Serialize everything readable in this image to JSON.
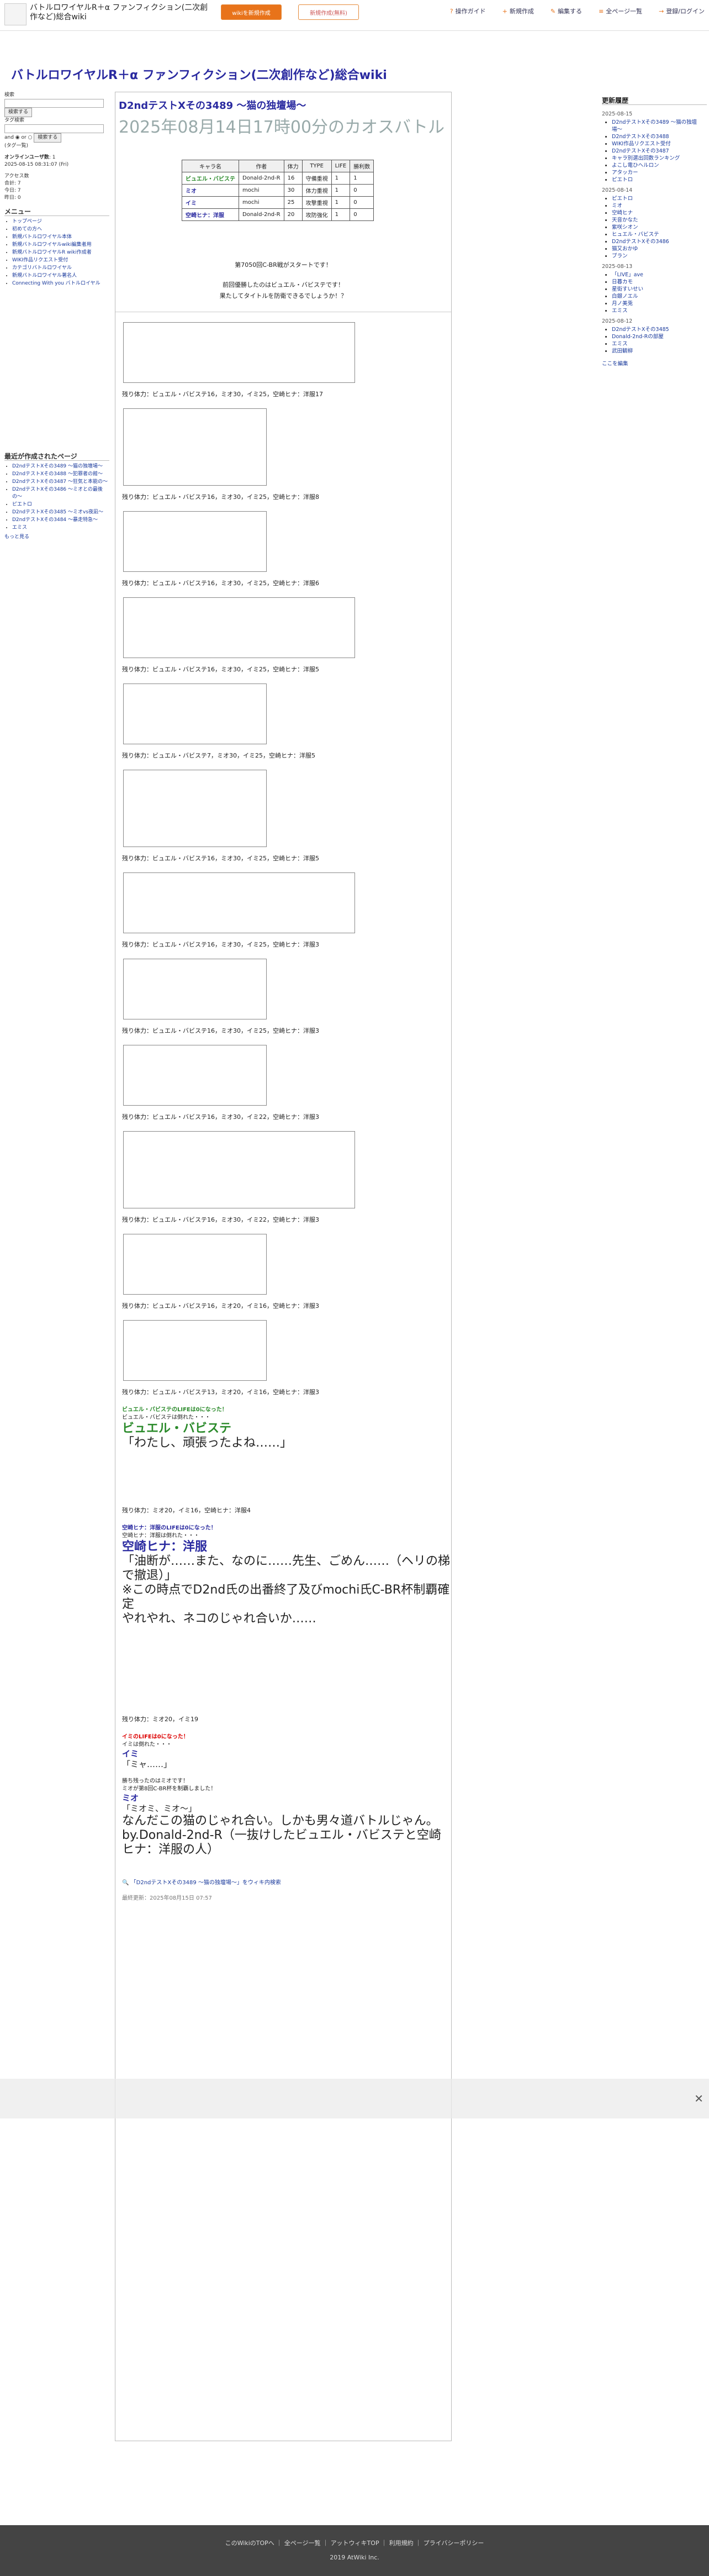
{
  "header": {
    "site_name": "バトルロワイヤルR＋α ファンフィクション(二次創作など)総合wiki",
    "btn1": "wikiを新規作成",
    "btn2": "新規作成(無料)",
    "nav": [
      {
        "icon": "?",
        "label": "操作ガイド"
      },
      {
        "icon": "+",
        "label": "新規作成"
      },
      {
        "icon": "✎",
        "label": "編集する"
      },
      {
        "icon": "≡",
        "label": "全ページ一覧"
      },
      {
        "icon": "→",
        "label": "登録/ログイン"
      }
    ]
  },
  "site_title": "バトルロワイヤルR＋α ファンフィクション(二次創作など)総合wiki",
  "left": {
    "search_label": "検索",
    "search_btn": "検索する",
    "tag_label": "タグ検索",
    "and": "and",
    "or": "or",
    "tag_btn": "検索する",
    "tag_list": "(タグ一覧)",
    "online_label": "オンラインユーザ数",
    "online_value": "1",
    "updated": "2025-08-15 08:31:07 (Fri)",
    "access_label": "アクセス数",
    "access": [
      "合計: 7",
      "今日: 7",
      "昨日: 0"
    ],
    "menu_title": "メニュー",
    "menu_items": [
      "トップページ",
      "初めての方へ",
      "新規バトルロワイヤル本体",
      "新規バトルロワイヤルwiki編集者用",
      "新規バトルロワイヤルR wiki作成者",
      "WIKI作品リクエスト受付",
      "カテゴリバトルロワイヤル",
      "新規バトルロワイヤル著名人",
      "Connecting With you バトルロイヤル"
    ],
    "recent_title": "最近が作成されたページ",
    "recent_items": [
      "D2ndテストXその3489 〜猫の独壇場〜",
      "D2ndテストXその3488 〜犯罪者の館〜",
      "D2ndテストXその3487 〜狂気と本能の〜",
      "D2ndテストXその3486 〜ミオとの最後の〜",
      "ピエトロ",
      "D2ndテストXその3485 〜ミオvs夜凪〜",
      "D2ndテストXその3484 〜暴走特急〜",
      "エミス"
    ],
    "more": "もっと見る"
  },
  "right": {
    "title": "更新履歴",
    "groups": [
      {
        "date": "2025-08-15",
        "items": [
          "D2ndテストXその3489 〜猫の独壇場〜",
          "D2ndテストXその3488",
          "WIKI作品リクエスト受付",
          "D2ndテストXその3487",
          "キャラ別選出回数ランキング",
          "よこし電ひヘルロン",
          "アタッカー",
          "ピエトロ"
        ]
      },
      {
        "date": "2025-08-14",
        "items": [
          "ピエトロ",
          "ミオ",
          "空崎ヒナ",
          "天音かなた",
          "紫咲シオン",
          "ヒュエル・バビステ",
          "D2ndテストXその3486",
          "猫又おかゆ",
          "ブラン"
        ]
      },
      {
        "date": "2025-08-13",
        "items": [
          "「LIVE」ave",
          "日暮カモ",
          "星街すいせい",
          "白銀ノエル",
          "月ノ美兎",
          "エミス"
        ]
      },
      {
        "date": "2025-08-12",
        "items": [
          "D2ndテストXその3485",
          "Donald-2nd-Rの部屋",
          "エミス",
          "武田観柳"
        ]
      }
    ],
    "more": "ここを編集"
  },
  "page": {
    "title": "D2ndテストXその3489 〜猫の独壇場〜",
    "subtitle": "2025年08月14日17時00分のカオスバトル"
  },
  "roster": {
    "headers": [
      "キャラ名",
      "作者",
      "体力",
      "TYPE",
      "LIFE",
      "勝利数"
    ],
    "rows": [
      [
        "ビュエル・バビステ",
        "Donald-2nd-R",
        "16",
        "守備重視",
        "1",
        "1"
      ],
      [
        "ミオ",
        "mochi",
        "30",
        "体力重視",
        "1",
        "0"
      ],
      [
        "イミ",
        "mochi",
        "25",
        "攻撃重視",
        "1",
        "0"
      ],
      [
        "空崎ヒナ：洋服",
        "Donald-2nd-R",
        "20",
        "攻防強化",
        "1",
        "0"
      ]
    ]
  },
  "intro": [
    "第7050回C-BR戦がスタートです！",
    "前回優勝したのはビュエル・バビステです！",
    "果たしてタイトルを防衛できるでしょうか！？"
  ],
  "hp_lines": [
    "残り体力：ビュエル・バビステ16，ミオ30，イミ25，空崎ヒナ：洋服17",
    "残り体力：ビュエル・バビステ16，ミオ30，イミ25，空崎ヒナ：洋服8",
    "残り体力：ビュエル・バビステ16，ミオ30，イミ25，空崎ヒナ：洋服6",
    "残り体力：ビュエル・バビステ16，ミオ30，イミ25，空崎ヒナ：洋服5",
    "残り体力：ビュエル・バビステ7，ミオ30，イミ25，空崎ヒナ：洋服5",
    "残り体力：ビュエル・バビステ16，ミオ30，イミ25，空崎ヒナ：洋服5",
    "残り体力：ビュエル・バビステ16，ミオ30，イミ25，空崎ヒナ：洋服3",
    "残り体力：ビュエル・バビステ16，ミオ30，イミ25，空崎ヒナ：洋服3",
    "残り体力：ビュエル・バビステ16，ミオ30，イミ22，空崎ヒナ：洋服3",
    "残り体力：ビュエル・バビステ16，ミオ30，イミ22，空崎ヒナ：洋服3",
    "残り体力：ビュエル・バビステ16，ミオ20，イミ16，空崎ヒナ：洋服3",
    "残り体力：ビュエル・バビステ13，ミオ20，イミ16，空崎ヒナ：洋服3"
  ],
  "end": {
    "fall1": "ビュエル・バビステのLIFEは0になった！",
    "fall2": "ビュエル・バビステは倒れた・・・",
    "fall_name": "ビュエル・バビステ",
    "fall_quote": "「わたし、頑張ったよね……」",
    "hp2": "残り体力：ミオ20，イミ16，空崎ヒナ：洋服4",
    "hina1": "空崎ヒナ：洋服のLIFEは0になった！",
    "hina2": "空崎ヒナ：洋服は倒れた・・・",
    "hina_name": "空崎ヒナ：洋服",
    "hina_quote": "「油断が……また、なのに……先生、ごめん……（ヘリの梯で撤退）」",
    "note": "※この時点でD2nd氏の出番終了及びmochi氏C-BR杯制覇確定",
    "note2": "やれやれ、ネコのじゃれ合いか……",
    "hp3": "残り体力：ミオ20，イミ19",
    "imi1": "イミのLIFEは0になった！",
    "imi2": "イミは倒れた・・・",
    "imi_name": "イミ",
    "imi_quote": "「ミャ……」",
    "win1": "勝ち残ったのはミオです！",
    "win2": "ミオが第8回C-BR杯を制覇しました！",
    "win_name": "ミオ",
    "win_quote": "「ミオミ、ミオ〜」",
    "closing": "なんだこの猫のじゃれ合い。しかも男々道バトルじゃん。",
    "by": "by.Donald-2nd-R（一抜けしたビュエル・バビステと空崎ヒナ：洋服の人）",
    "edit_link": "「D2ndテストXその3489 〜猫の独壇場〜」をウィキ内検索",
    "last_update": "最終更新：2025年08月15日 07:57"
  },
  "footer": {
    "links": [
      "このWikiのTOPへ",
      "全ページ一覧",
      "アットウィキTOP",
      "利用規約",
      "プライバシーポリシー"
    ],
    "copyright": "2019 AtWiki Inc."
  }
}
